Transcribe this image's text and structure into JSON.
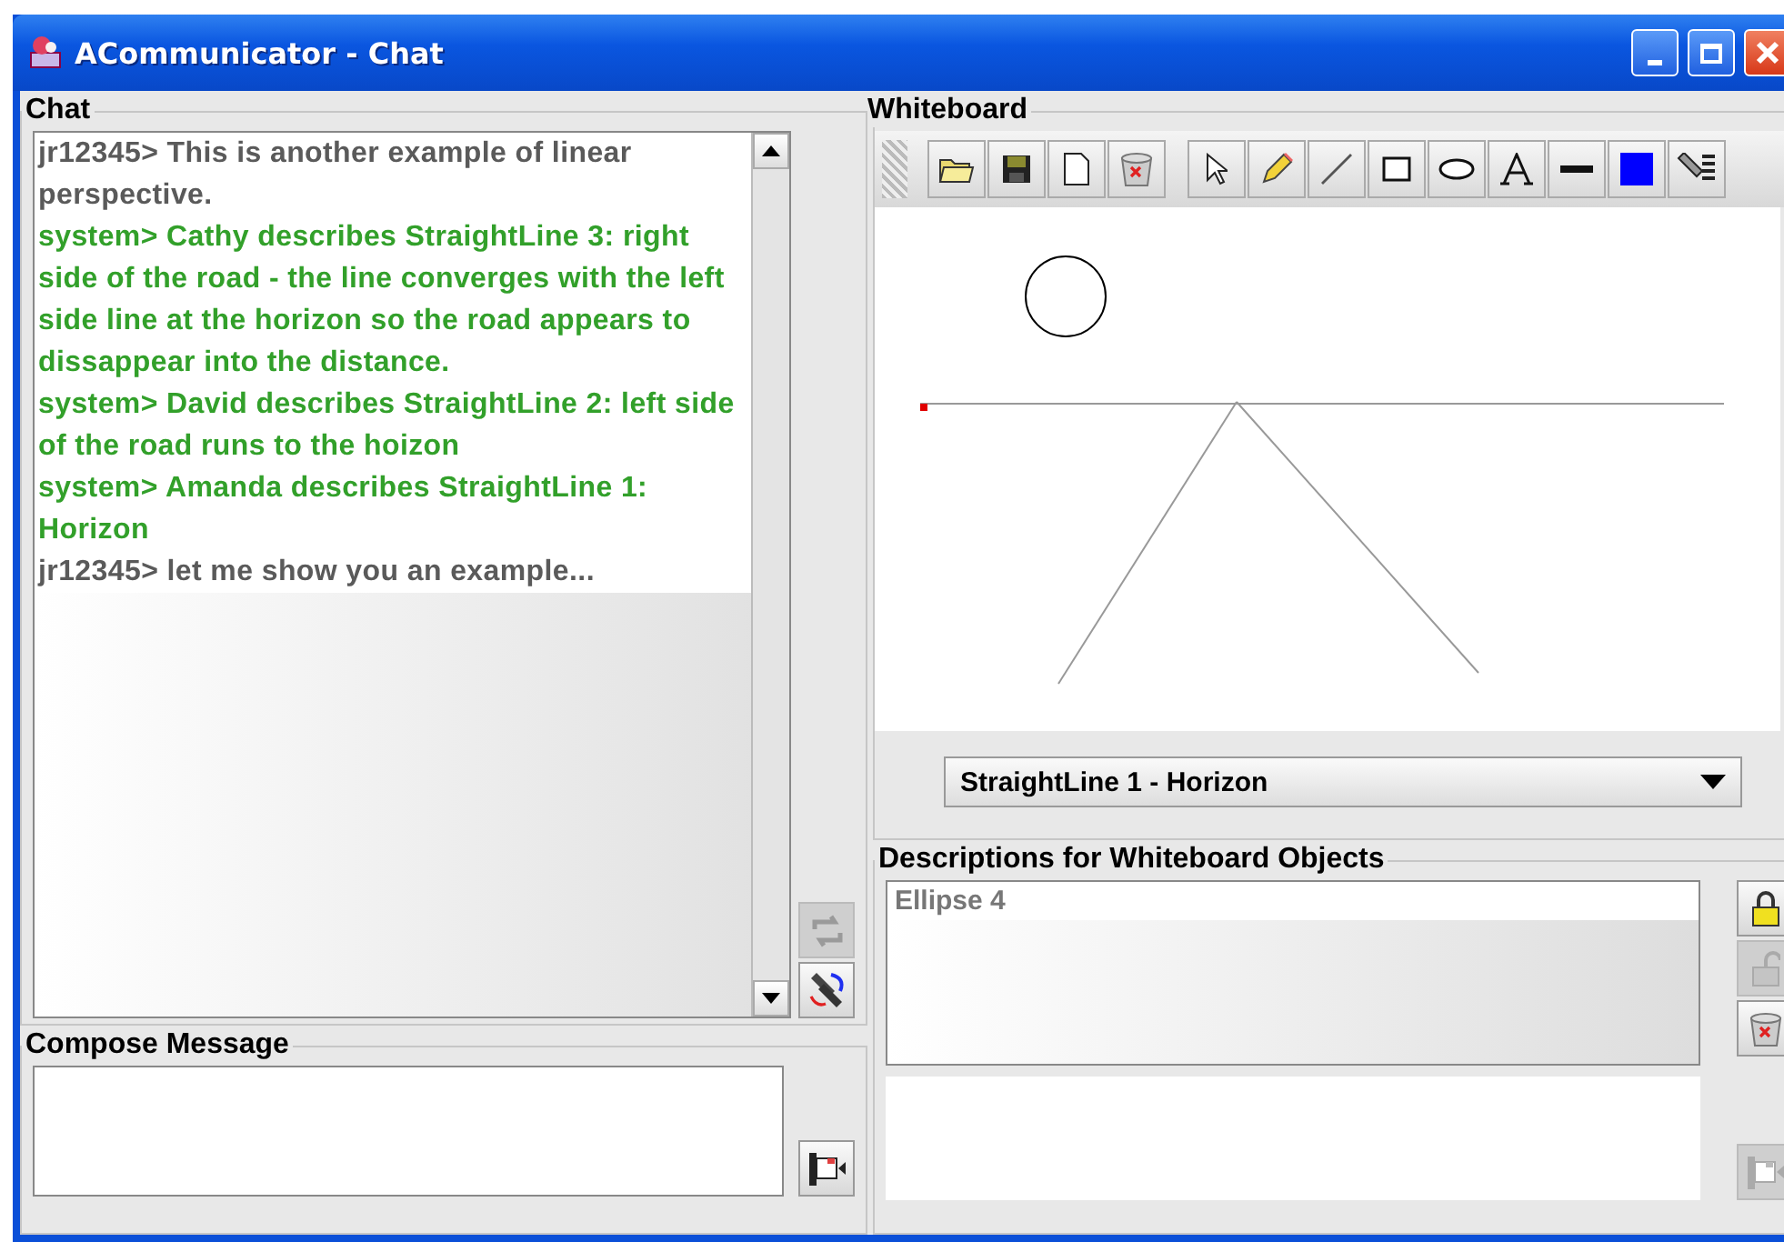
{
  "window": {
    "title": "ACommunicator - Chat"
  },
  "chat": {
    "title": "Chat",
    "messages": [
      {
        "kind": "user",
        "text": "jr12345> This is another example of linear perspective."
      },
      {
        "kind": "system",
        "text": "system> Cathy describes StraightLine 3: right side of the road - the line converges with the left side line at the horizon so the road appears to dissappear into the distance."
      },
      {
        "kind": "system",
        "text": "system> David describes StraightLine 2: left side of the road runs to the hoizon"
      },
      {
        "kind": "system",
        "text": "system> Amanda describes StraightLine 1: Horizon"
      },
      {
        "kind": "user",
        "text": "jr12345> let me show you an example..."
      }
    ],
    "buttons": [
      {
        "kind": "refresh",
        "disabled": true
      },
      {
        "kind": "pens",
        "disabled": false
      }
    ]
  },
  "compose": {
    "title": "Compose Message",
    "send_button": {
      "disabled": false
    }
  },
  "whiteboard": {
    "title": "Whiteboard",
    "toolbar": [
      {
        "kind": "open"
      },
      {
        "kind": "save"
      },
      {
        "kind": "new"
      },
      {
        "kind": "delete"
      },
      {
        "kind": "separator"
      },
      {
        "kind": "pointer"
      },
      {
        "kind": "pencil"
      },
      {
        "kind": "line"
      },
      {
        "kind": "rectangle"
      },
      {
        "kind": "ellipse"
      },
      {
        "kind": "text"
      },
      {
        "kind": "stroke"
      },
      {
        "kind": "color"
      },
      {
        "kind": "pen"
      }
    ],
    "dropdown": {
      "value": "StraightLine 1 - Horizon"
    }
  },
  "descriptions": {
    "title": "Descriptions for Whiteboard Objects",
    "items": [
      {
        "text": "Ellipse 4",
        "selected": false
      }
    ],
    "buttons": [
      {
        "kind": "lock",
        "disabled": false
      },
      {
        "kind": "unlock",
        "disabled": true
      },
      {
        "kind": "delete",
        "disabled": false
      }
    ],
    "send_button": {
      "disabled": true
    }
  }
}
